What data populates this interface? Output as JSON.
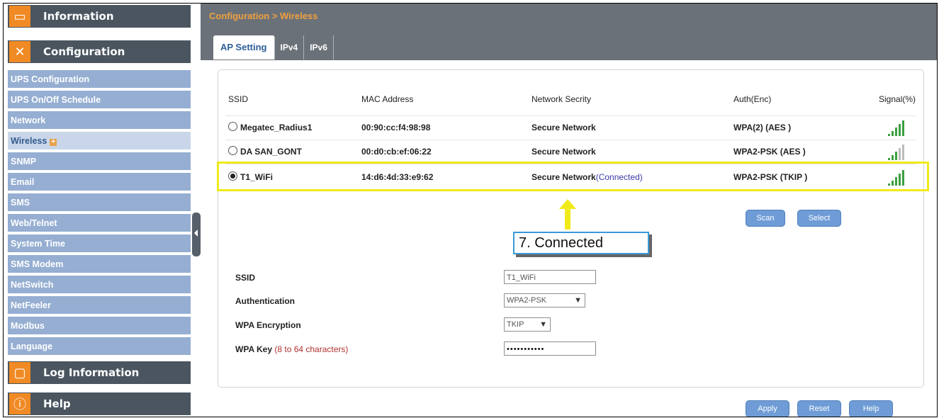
{
  "sidebar": {
    "information": "Information",
    "configuration": "Configuration",
    "items": [
      {
        "label": "UPS Configuration"
      },
      {
        "label": "UPS On/Off Schedule"
      },
      {
        "label": "Network"
      },
      {
        "label": "Wireless"
      },
      {
        "label": "SNMP"
      },
      {
        "label": "Email"
      },
      {
        "label": "SMS"
      },
      {
        "label": "Web/Telnet"
      },
      {
        "label": "System Time"
      },
      {
        "label": "SMS Modem"
      },
      {
        "label": "NetSwitch"
      },
      {
        "label": "NetFeeler"
      },
      {
        "label": "Modbus"
      },
      {
        "label": "Language"
      }
    ],
    "log_information": "Log Information",
    "help": "Help"
  },
  "header": {
    "breadcrumb": "Configuration > Wireless",
    "tabs": [
      {
        "label": "AP Setting"
      },
      {
        "label": "IPv4"
      },
      {
        "label": "IPv6"
      }
    ]
  },
  "table": {
    "columns": [
      "SSID",
      "MAC Address",
      "Network Secrity",
      "Auth(Enc)",
      "Signal(%)"
    ],
    "rows": [
      {
        "ssid": "Megatec_Radius1",
        "mac": "00:90:cc:f4:98:98",
        "security": "Secure Network",
        "connected": "",
        "auth": "WPA(2) (AES )",
        "signal_bars": 5,
        "selected": false
      },
      {
        "ssid": "DA SAN_GONT",
        "mac": "00:d0:cb:ef:06:22",
        "security": "Secure Network",
        "connected": "",
        "auth": "WPA2-PSK (AES )",
        "signal_bars": 3,
        "selected": false
      },
      {
        "ssid": "T1_WiFi",
        "mac": "14:d6:4d:33:e9:62",
        "security": "Secure Network",
        "connected": "(Connected)",
        "auth": "WPA2-PSK (TKIP )",
        "signal_bars": 5,
        "selected": true
      }
    ]
  },
  "buttons": {
    "scan": "Scan",
    "select": "Select",
    "apply": "Apply",
    "reset": "Reset",
    "help": "Help"
  },
  "callout": "7. Connected",
  "form": {
    "ssid_label": "SSID",
    "ssid_value": "T1_WiFi",
    "auth_label": "Authentication",
    "auth_value": "WPA2-PSK",
    "enc_label": "WPA Encryption",
    "enc_value": "TKIP",
    "key_label": "WPA Key",
    "key_hint": "(8 to 64 characters)",
    "key_value": "•••••••••••"
  },
  "colors": {
    "accent_orange": "#f08a24",
    "sidebar_sub": "#95aed2",
    "highlight": "#f0ea1a",
    "button": "#6f9cd6"
  }
}
